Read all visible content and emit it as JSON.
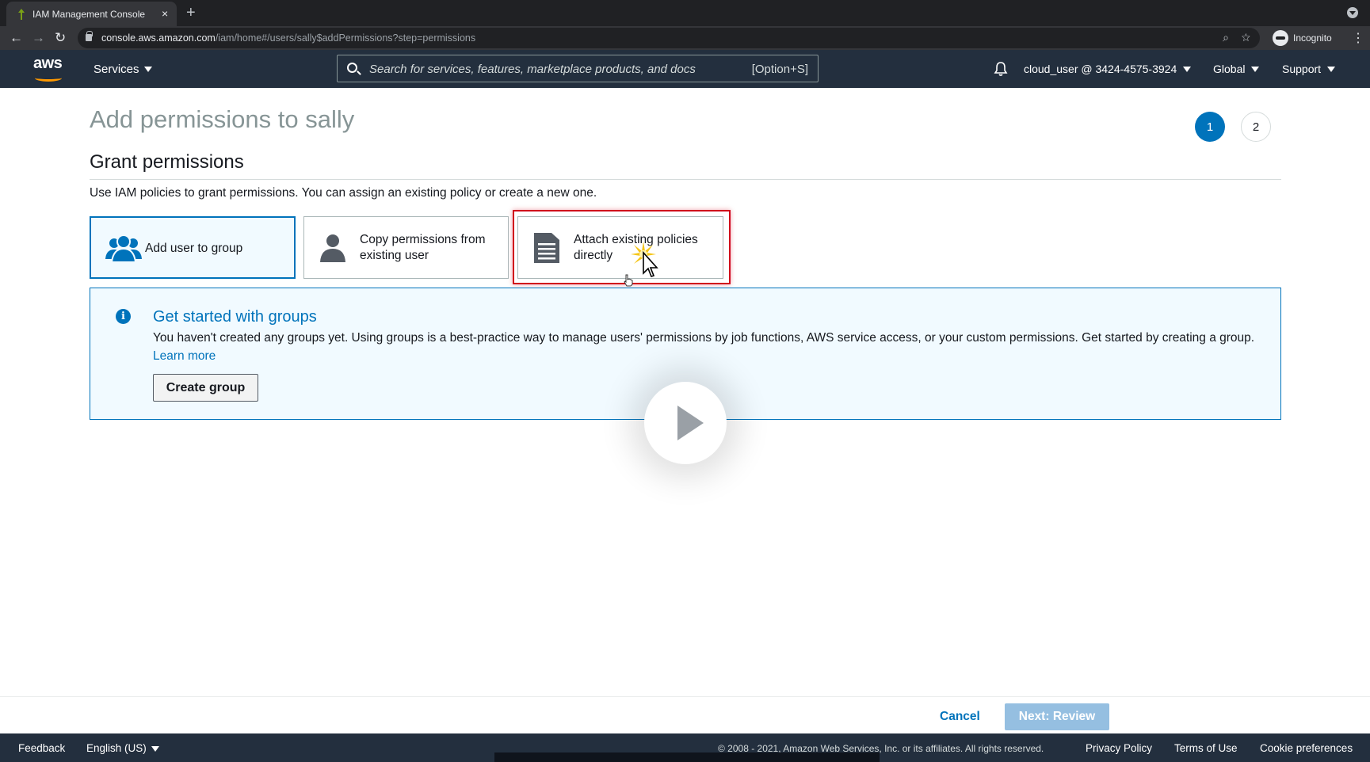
{
  "browser": {
    "tab_title": "IAM Management Console",
    "tab_close": "×",
    "new_tab": "+",
    "url_host": "console.aws.amazon.com",
    "url_path": "/iam/home#/users/sally$addPermissions?step=permissions",
    "profile_label": "Incognito"
  },
  "aws_nav": {
    "logo_text": "aws",
    "services_label": "Services",
    "search_placeholder": "Search for services, features, marketplace products, and docs",
    "search_shortcut": "[Option+S]",
    "account_label": "cloud_user @ 3424-4575-3924",
    "region_label": "Global",
    "support_label": "Support"
  },
  "page": {
    "title": "Add permissions to sally",
    "steps": [
      "1",
      "2"
    ],
    "active_step": 1,
    "section_title": "Grant permissions",
    "description": "Use IAM policies to grant permissions. You can assign an existing policy or create a new one."
  },
  "options": [
    {
      "label": "Add user to group",
      "icon": "group-icon",
      "selected": true
    },
    {
      "label": "Copy permissions from existing user",
      "icon": "user-icon",
      "selected": false
    },
    {
      "label": "Attach existing policies directly",
      "icon": "document-icon",
      "selected": false
    }
  ],
  "info_panel": {
    "icon": "info-icon",
    "icon_glyph": "i",
    "title": "Get started with groups",
    "body": "You haven't created any groups yet. Using groups is a best-practice way to manage users' permissions by job functions, AWS service access, or your custom permissions. Get started by creating a group.",
    "link": "Learn more",
    "button": "Create group"
  },
  "actions": {
    "cancel": "Cancel",
    "next": "Next: Review"
  },
  "footer": {
    "feedback": "Feedback",
    "language": "English (US)",
    "copyright": "© 2008 - 2021, Amazon Web Services, Inc. or its affiliates. All rights reserved.",
    "privacy": "Privacy Policy",
    "terms": "Terms of Use",
    "cookies": "Cookie preferences"
  },
  "colors": {
    "aws_nav_bg": "#232f3e",
    "aws_orange": "#ff9900",
    "primary_blue": "#0073bb",
    "highlight_red": "#d0021b"
  }
}
